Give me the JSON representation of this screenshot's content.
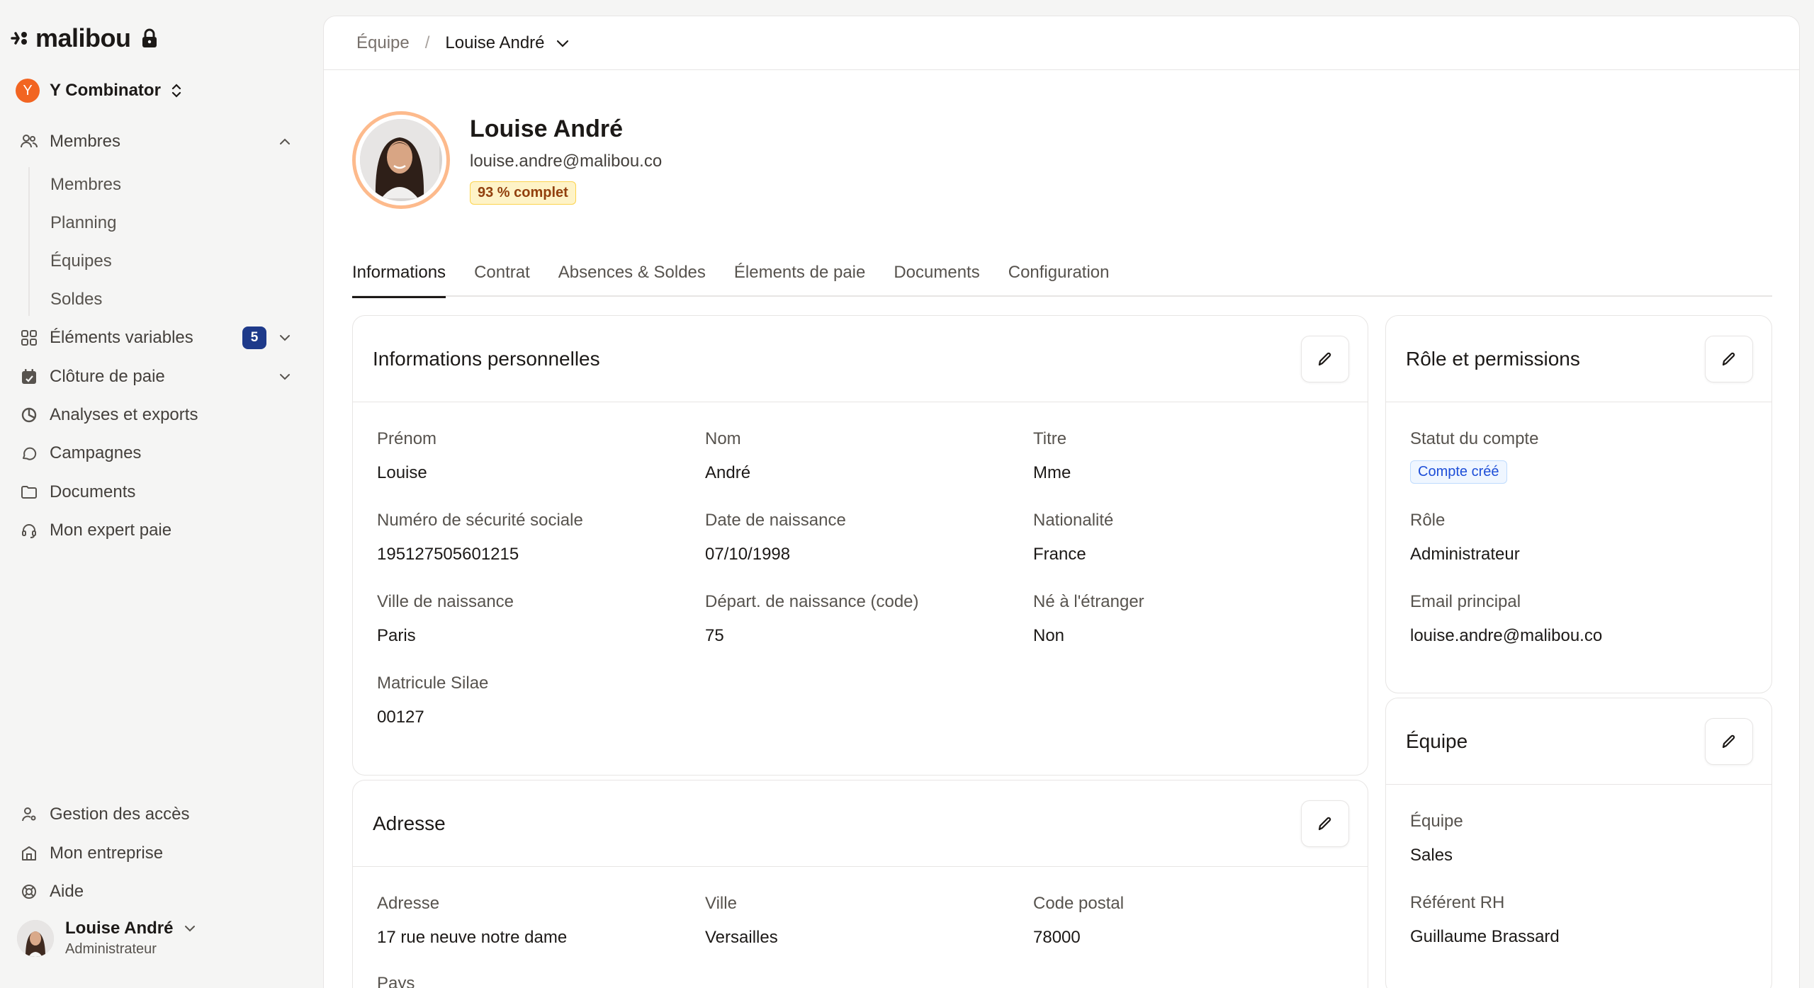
{
  "app": {
    "logo_text": "malibou",
    "company_initial": "Y",
    "company_name": "Y Combinator"
  },
  "sidebar": {
    "members_section": "Membres",
    "sub_items": [
      "Membres",
      "Planning",
      "Équipes",
      "Soldes"
    ],
    "items": [
      {
        "label": "Éléments variables",
        "badge": "5"
      },
      {
        "label": "Clôture de paie"
      },
      {
        "label": "Analyses et exports"
      },
      {
        "label": "Campagnes"
      },
      {
        "label": "Documents"
      },
      {
        "label": "Mon expert paie"
      }
    ],
    "bottom_items": [
      "Gestion des accès",
      "Mon entreprise",
      "Aide"
    ],
    "user": {
      "name": "Louise André",
      "role": "Administrateur"
    }
  },
  "breadcrumb": {
    "parent": "Équipe",
    "separator": "/",
    "current": "Louise André"
  },
  "profile": {
    "name": "Louise André",
    "email": "louise.andre@malibou.co",
    "completion": "93 % complet"
  },
  "tabs": [
    "Informations",
    "Contrat",
    "Absences & Soldes",
    "Élements de paie",
    "Documents",
    "Configuration"
  ],
  "personal": {
    "title": "Informations personnelles",
    "fields": [
      {
        "label": "Prénom",
        "value": "Louise"
      },
      {
        "label": "Nom",
        "value": "André"
      },
      {
        "label": "Titre",
        "value": "Mme"
      },
      {
        "label": "Numéro de sécurité sociale",
        "value": "195127505601215"
      },
      {
        "label": "Date de naissance",
        "value": "07/10/1998"
      },
      {
        "label": "Nationalité",
        "value": "France"
      },
      {
        "label": "Ville de naissance",
        "value": "Paris"
      },
      {
        "label": "Départ. de naissance (code)",
        "value": "75"
      },
      {
        "label": "Né à l'étranger",
        "value": "Non"
      },
      {
        "label": "Matricule Silae",
        "value": "00127"
      }
    ]
  },
  "address": {
    "title": "Adresse",
    "fields": [
      {
        "label": "Adresse",
        "value": "17 rue neuve notre dame"
      },
      {
        "label": "Ville",
        "value": "Versailles"
      },
      {
        "label": "Code postal",
        "value": "78000"
      },
      {
        "label": "Pays",
        "value": ""
      }
    ]
  },
  "role": {
    "title": "Rôle et permissions",
    "status_label": "Statut du compte",
    "status_value": "Compte créé",
    "role_label": "Rôle",
    "role_value": "Administrateur",
    "email_label": "Email principal",
    "email_value": "louise.andre@malibou.co"
  },
  "team": {
    "title": "Équipe",
    "team_label": "Équipe",
    "team_value": "Sales",
    "hr_label": "Référent RH",
    "hr_value": "Guillaume Brassard"
  },
  "colors": {
    "accent_orange": "#f26522",
    "badge_navy": "#1e3a8a"
  }
}
